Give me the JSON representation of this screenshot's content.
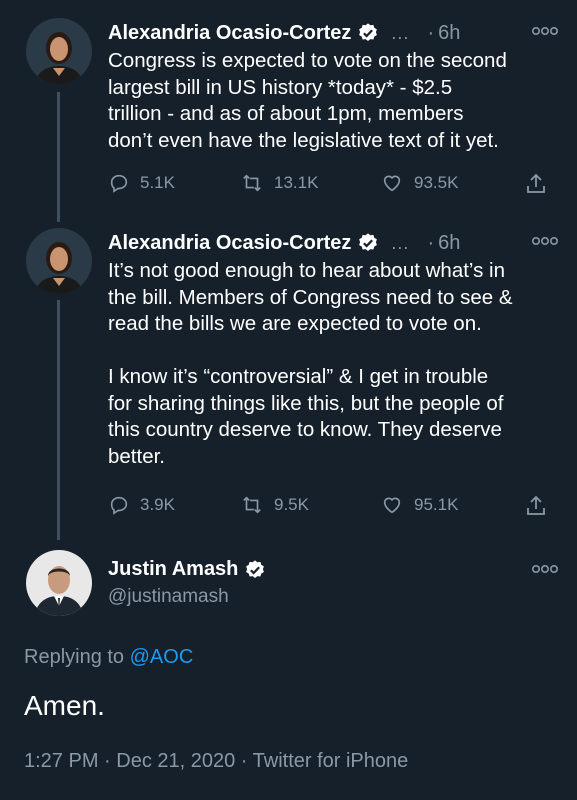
{
  "tweets": [
    {
      "author": "Alexandria Ocasio-Cortez",
      "ellipsis": "...",
      "dot": "·",
      "time": "6h",
      "text": "Congress is expected to vote on the second\nlargest bill in US history *today* - $2.5\ntrillion - and as of about 1pm, members\ndon’t even have the legislative text of it yet.",
      "replies": "5.1K",
      "retweets": "13.1K",
      "likes": "93.5K"
    },
    {
      "author": "Alexandria Ocasio-Cortez",
      "ellipsis": "...",
      "dot": "·",
      "time": "6h",
      "text": "It’s not good enough to hear about what’s in\nthe bill. Members of Congress need to see &\nread the bills we are expected to vote on.\n\nI know it’s “controversial” & I get in trouble\nfor sharing things like this, but the people of\nthis country deserve to know. They deserve\nbetter.",
      "replies": "3.9K",
      "retweets": "9.5K",
      "likes": "95.1K"
    }
  ],
  "main_tweet": {
    "author": "Justin Amash",
    "handle": "@justinamash",
    "replying_prefix": "Replying to ",
    "replying_to": "@AOC",
    "text": "Amen.",
    "meta": "1:27 PM · Dec 21, 2020 · Twitter for iPhone"
  },
  "colors": {
    "background": "#15202b",
    "secondary_text": "#8b98a5",
    "link": "#1d9bf0"
  },
  "icons": [
    "verified-badge-icon",
    "more-options-icon",
    "reply-icon",
    "retweet-icon",
    "like-icon",
    "share-icon"
  ]
}
